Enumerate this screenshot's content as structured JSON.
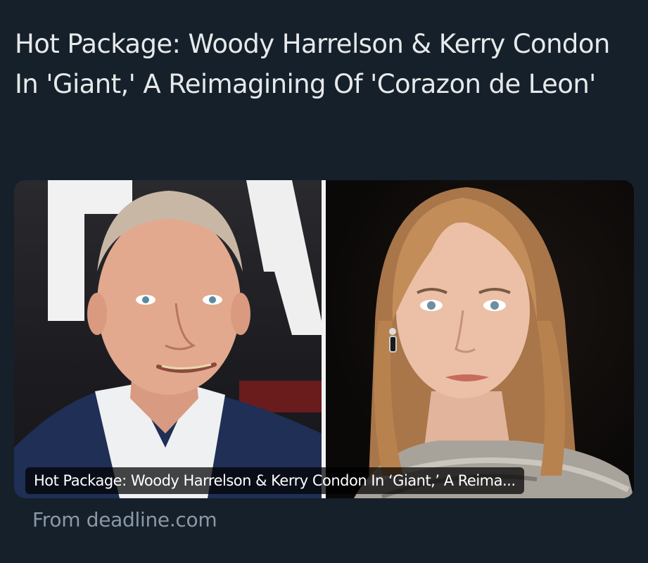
{
  "post": {
    "text": "Hot Package: Woody Harrelson & Kerry Condon In 'Giant,' A Reimagining Of 'Corazon de Leon'"
  },
  "card": {
    "caption": "Hot Package: Woody Harrelson & Kerry Condon In ‘Giant,’ A Reima...",
    "source": "From deadline.com",
    "images": {
      "left": "woody-harrelson-photo",
      "right": "kerry-condon-photo"
    }
  },
  "colors": {
    "background": "#15202b",
    "text": "#e7e9ea",
    "muted": "#8b98a5"
  }
}
